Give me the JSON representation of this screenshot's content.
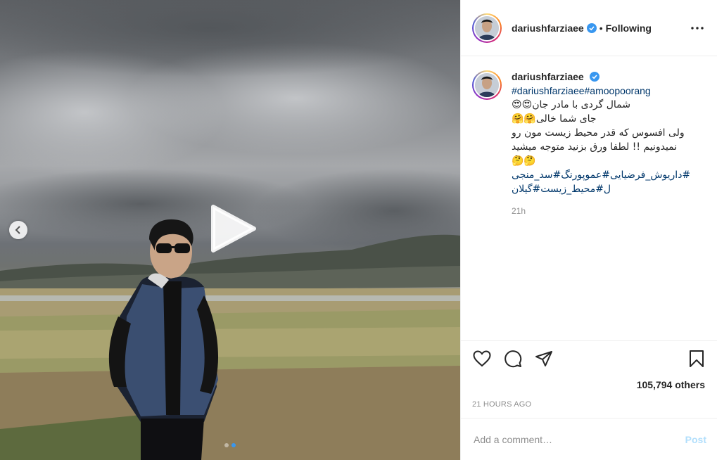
{
  "post": {
    "username": "dariushfarziaee",
    "follow_status": "Following",
    "separator": "•",
    "more_label": "•••"
  },
  "caption": {
    "username": "dariushfarziaee",
    "hashtags_line": "#dariushfarziaee#amoopoorang",
    "lines": [
      "شمال گردی با مادر جان😍😍",
      "جای شما خالی🤗🤗",
      "ولی افسوس که قدر محیط زیست مون رو",
      "نمیدونیم !! لطفا ورق بزنید متوجه میشید",
      "🤔🤔"
    ],
    "tag_lines": [
      "#داریوش_فرضیایی#عموپورنگ#سد_منجی",
      "ل#محیط_زیست#گیلان"
    ],
    "relative_time": "21h"
  },
  "stats": {
    "likes": "105,794 others",
    "posted_time": "21 HOURS AGO"
  },
  "comment": {
    "placeholder": "Add a comment…",
    "post_label": "Post"
  },
  "media": {
    "carousel_count": 2,
    "active_index": 0
  },
  "icons": {
    "verified": "verified-badge-icon",
    "like": "heart-icon",
    "comment": "comment-icon",
    "share": "share-icon",
    "save": "bookmark-icon",
    "play": "play-icon",
    "prev": "chevron-left-icon"
  },
  "colors": {
    "verified": "#3897f0",
    "link": "#00376b",
    "muted": "#8e8e8e",
    "post_disabled": "#b2dffc"
  }
}
